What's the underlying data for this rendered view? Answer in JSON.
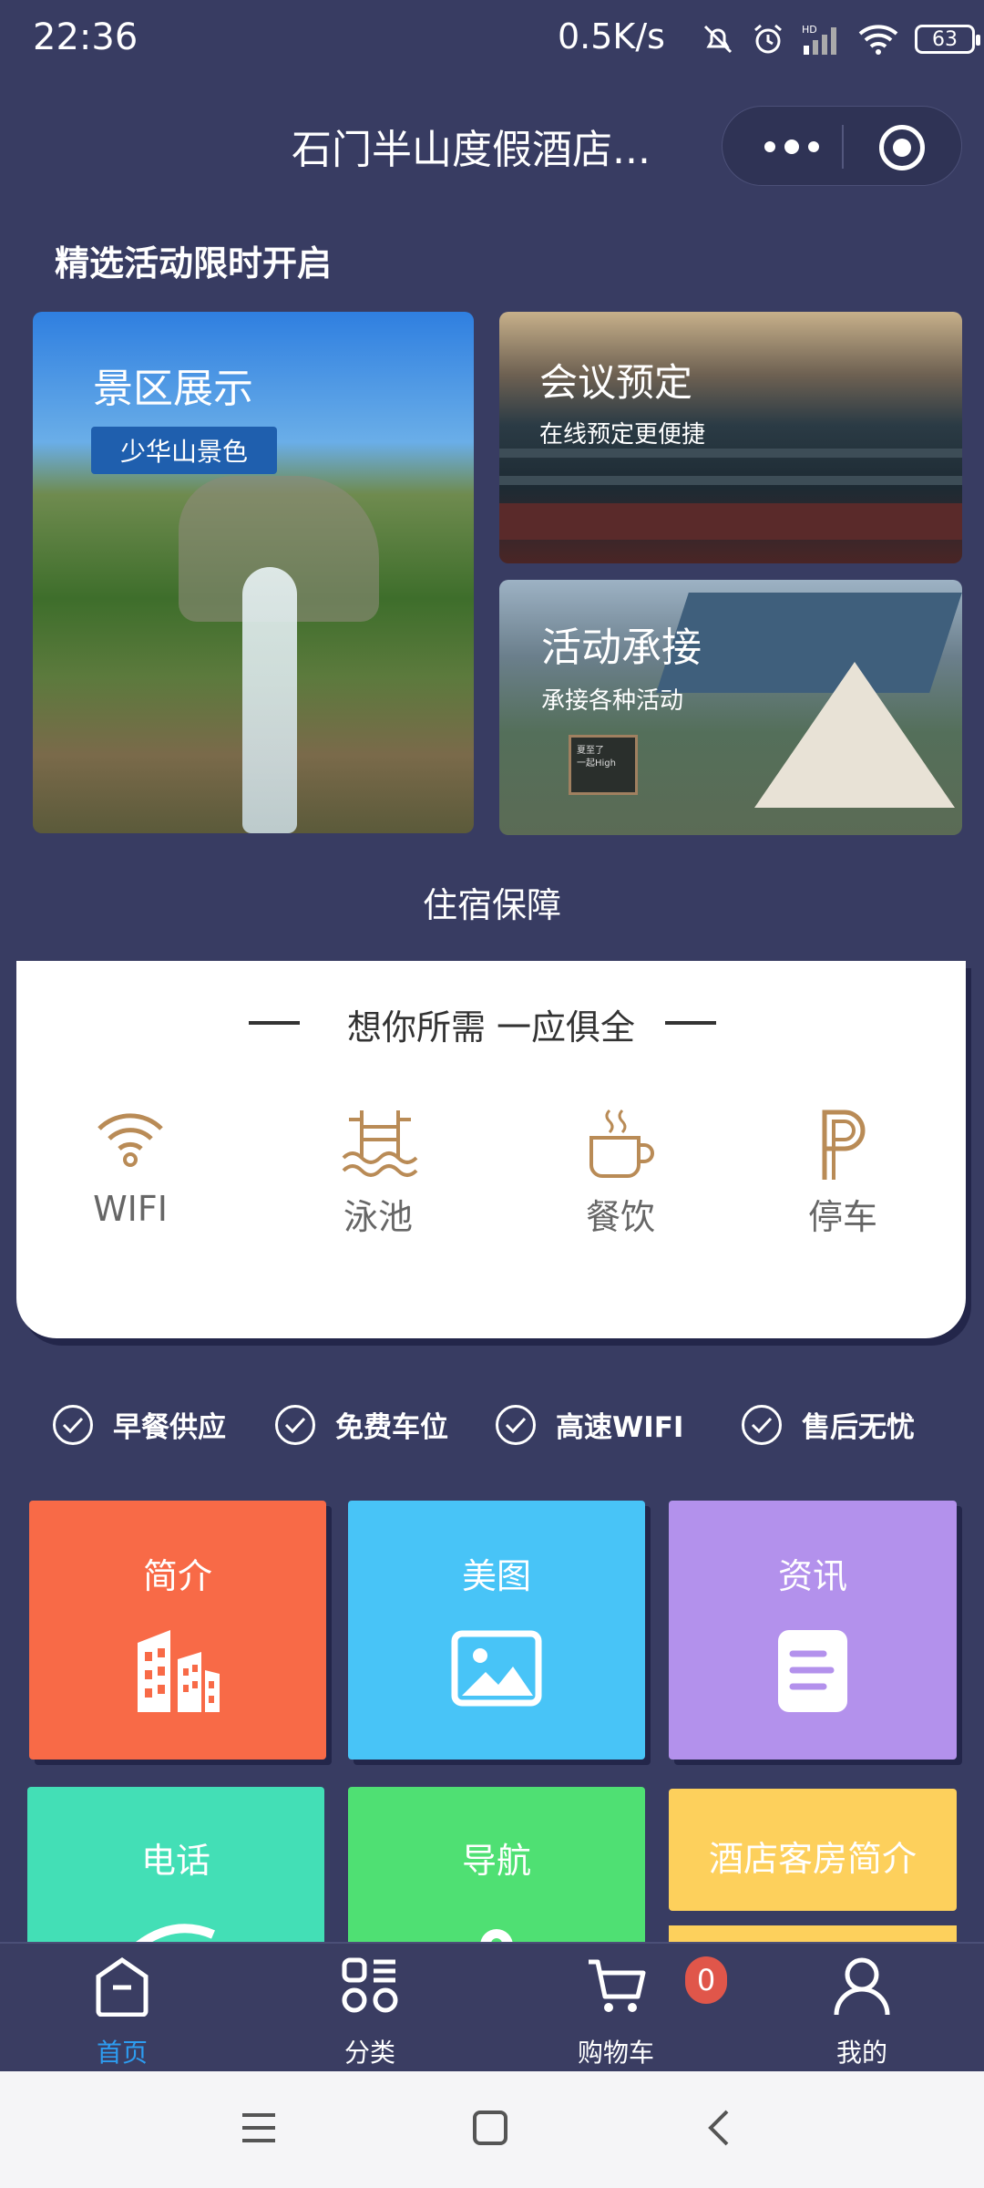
{
  "status_bar": {
    "time": "22:36",
    "net_speed": "0.5K/s",
    "battery": "63"
  },
  "header": {
    "title": "石门半山度假酒店..."
  },
  "featured": {
    "section_title": "精选活动限时开启",
    "scenic": {
      "title": "景区展示",
      "tag": "少华山景色"
    },
    "meeting": {
      "title": "会议预定",
      "subtitle": "在线预定更便捷"
    },
    "event": {
      "title": "活动承接",
      "subtitle": "承接各种活动",
      "board_text": "夏至了\n一起High"
    }
  },
  "stay": {
    "section_title": "住宿保障",
    "slogan": "想你所需 一应俱全",
    "amenities": [
      {
        "label": "WIFI",
        "icon": "wifi-icon"
      },
      {
        "label": "泳池",
        "icon": "pool-icon"
      },
      {
        "label": "餐饮",
        "icon": "coffee-cup-icon"
      },
      {
        "label": "停车",
        "icon": "parking-icon"
      }
    ],
    "accent_color": "#b98b56"
  },
  "guarantees": [
    "早餐供应",
    "免费车位",
    "高速WIFI",
    "售后无忧"
  ],
  "tiles": [
    {
      "label": "简介",
      "color": "#f86a47",
      "icon": "building-icon"
    },
    {
      "label": "美图",
      "color": "#48c4f7",
      "icon": "image-icon"
    },
    {
      "label": "资讯",
      "color": "#b391ec",
      "icon": "document-icon"
    },
    {
      "label": "电话",
      "color": "#43dfb6",
      "icon": "phone-icon"
    },
    {
      "label": "导航",
      "color": "#4fe073",
      "icon": "location-icon"
    },
    {
      "label": "酒店客房简介",
      "color": "#fdd05c",
      "icon": ""
    }
  ],
  "tabbar": {
    "items": [
      {
        "label": "首页",
        "icon": "home-icon",
        "active": true
      },
      {
        "label": "分类",
        "icon": "category-icon",
        "active": false
      },
      {
        "label": "购物车",
        "icon": "cart-icon",
        "active": false
      },
      {
        "label": "我的",
        "icon": "user-icon",
        "active": false
      }
    ],
    "cart_count": "0",
    "active_color": "#2d9cf0"
  },
  "system_nav": [
    "menu-icon",
    "home-square-icon",
    "back-icon"
  ]
}
